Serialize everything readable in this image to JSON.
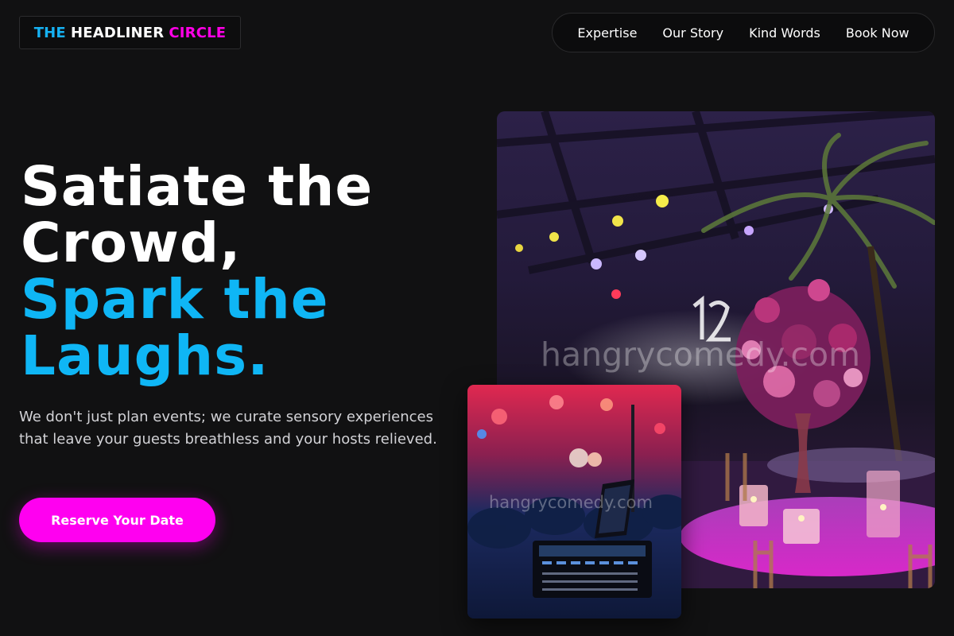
{
  "brand": {
    "word1": "THE",
    "word2": "HEADLINER",
    "word3": "CIRCLE"
  },
  "nav": {
    "items": [
      {
        "label": "Expertise"
      },
      {
        "label": "Our Story"
      },
      {
        "label": "Kind Words"
      },
      {
        "label": "Book Now"
      }
    ]
  },
  "hero": {
    "line1": "Satiate the",
    "line2": "Crowd,",
    "line3": "Spark the",
    "line4": "Laughs.",
    "subtext": "We don't just plan events; we curate sensory experiences that leave your guests breathless and your hosts relieved.",
    "cta_label": "Reserve Your Date"
  },
  "images": {
    "main_watermark": "hangrycomedy.com",
    "small_watermark": "hangrycomedy.com"
  },
  "colors": {
    "background": "#111112",
    "accent_blue": "#0fb6f5",
    "accent_magenta": "#ff00f0"
  }
}
